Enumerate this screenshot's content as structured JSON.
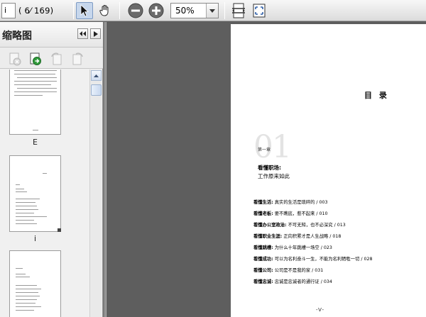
{
  "toolbar": {
    "page_input": "i",
    "page_count": "( 6⁄ 169)",
    "zoom_value": "50%"
  },
  "sidebar": {
    "title": "缩略图",
    "thumb_labels": [
      "E",
      "i"
    ]
  },
  "page": {
    "title": "目 录",
    "chapter_number": "01",
    "chapter_label": "第一章",
    "chapter_title_1": "看懂职场:",
    "chapter_title_2": "工作原来如此",
    "toc": [
      {
        "head": "看懂生活:",
        "rest": "真实的生活是琐碎的  / 003"
      },
      {
        "head": "看懂老板:",
        "rest": "要不瞧底，惹不起来  / 010"
      },
      {
        "head": "看懂办公室政治:",
        "rest": "不可无知，也不必深究  / 013"
      },
      {
        "head": "看懂职业生涯:",
        "rest": "正向积累才是人生战略  / 018"
      },
      {
        "head": "看懂跳槽:",
        "rest": "为什么十年跳槽一场空  / 023"
      },
      {
        "head": "看懂成功:",
        "rest": "可以为名利奋斗一生，不能为名利牺牲一切  / 028"
      },
      {
        "head": "看懂公司:",
        "rest": "公司是不是我的家  / 031"
      },
      {
        "head": "看懂忠诚:",
        "rest": "忠诚是忠诚者的通行证  / 034"
      }
    ],
    "footer": "-V-"
  }
}
